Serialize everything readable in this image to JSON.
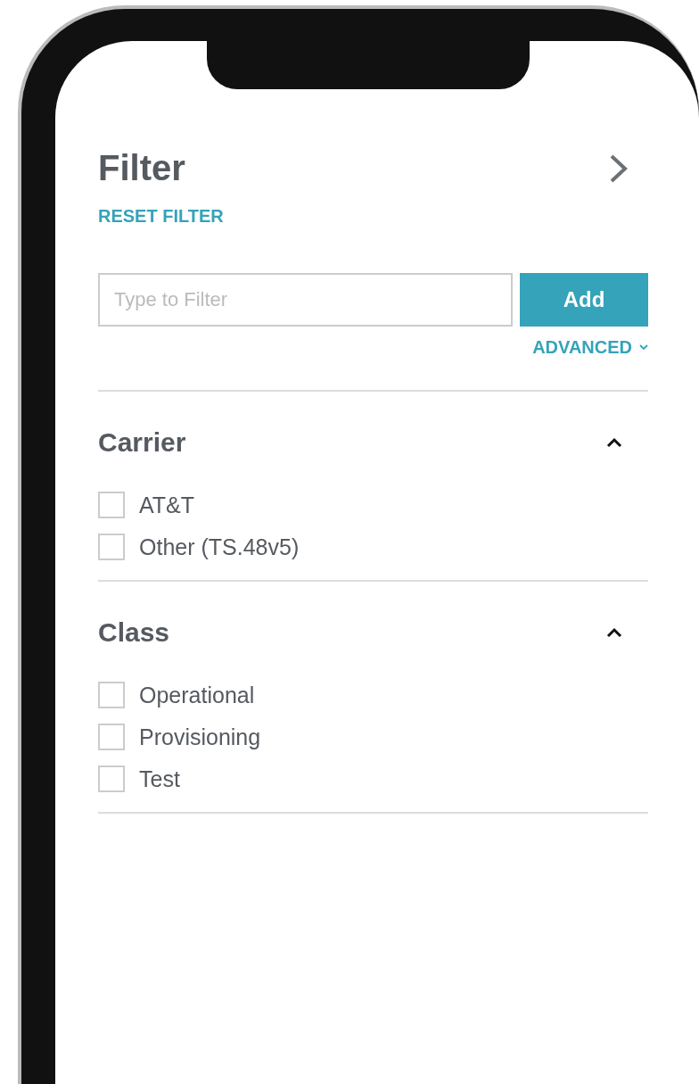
{
  "header": {
    "title": "Filter",
    "reset_link": "RESET FILTER"
  },
  "search": {
    "placeholder": "Type to Filter",
    "button": "Add",
    "advanced": "ADVANCED"
  },
  "sections": [
    {
      "title": "Carrier",
      "expanded": true,
      "options": [
        {
          "label": "AT&T",
          "checked": false
        },
        {
          "label": "Other (TS.48v5)",
          "checked": false
        }
      ]
    },
    {
      "title": "Class",
      "expanded": true,
      "options": [
        {
          "label": "Operational",
          "checked": false
        },
        {
          "label": "Provisioning",
          "checked": false
        },
        {
          "label": "Test",
          "checked": false
        }
      ]
    }
  ]
}
